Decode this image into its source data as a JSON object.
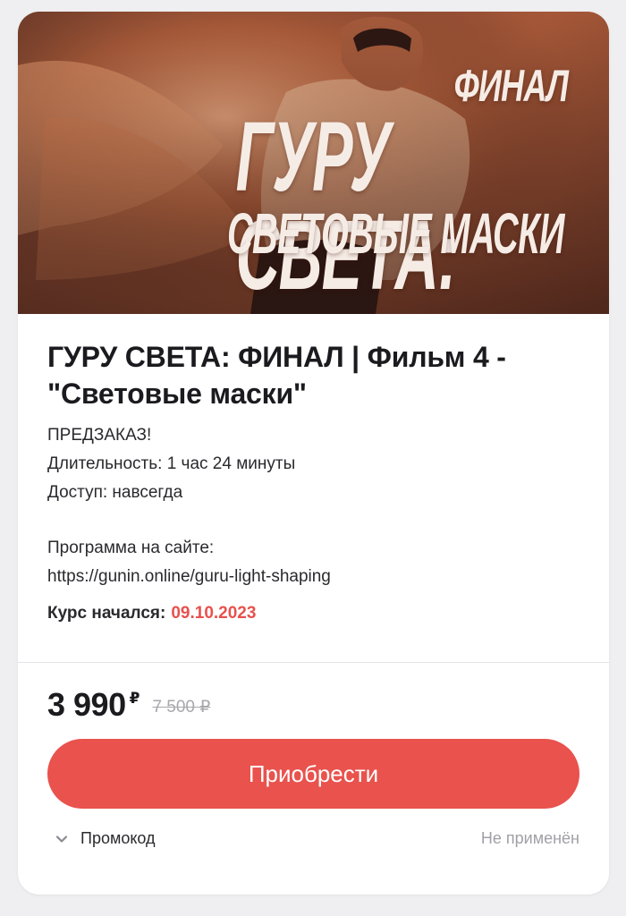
{
  "banner": {
    "line1": "ФИНАЛ",
    "line2": "ГУРУ СВЕТА:",
    "line3": "СВЕТОВЫЕ МАСКИ"
  },
  "product": {
    "title": "ГУРУ СВЕТА: ФИНАЛ | Фильм 4 - \"Световые маски\"",
    "preorder": "ПРЕДЗАКАЗ!",
    "duration": "Длительность: 1 час 24 минуты",
    "access": "Доступ: навсегда",
    "program_label": "Программа на сайте:",
    "program_url": "https://gunin.online/guru-light-shaping",
    "start_label": "Курс начался:",
    "start_date": "09.10.2023"
  },
  "pricing": {
    "price": "3 990",
    "currency": "₽",
    "old_price": "7 500 ₽"
  },
  "actions": {
    "buy_label": "Приобрести",
    "promo_label": "Промокод",
    "promo_status": "Не применён"
  },
  "colors": {
    "accent": "#e9524d",
    "date": "#e8514d"
  }
}
